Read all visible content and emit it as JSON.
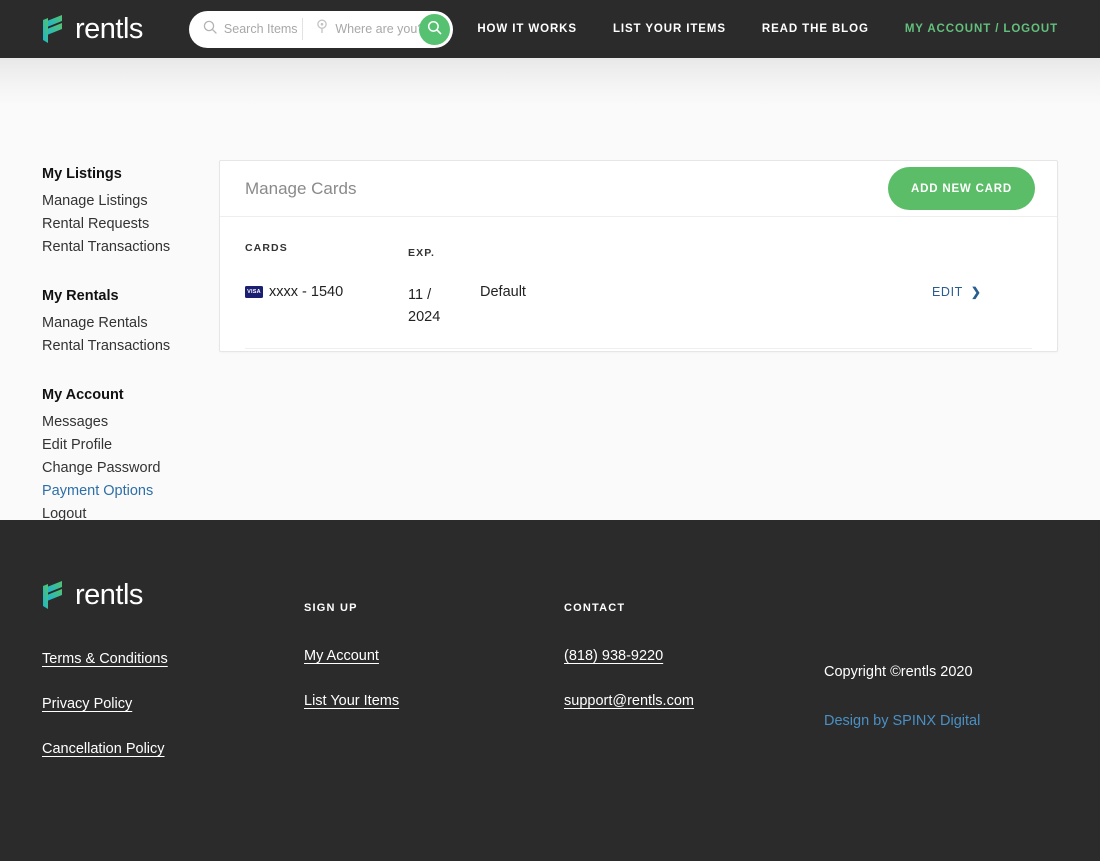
{
  "brand": {
    "name": "rentls",
    "logo_icon": "rentls-logo-mark",
    "accent_green": "#56c271",
    "accent_blue": "#2e6fa8",
    "dark": "#2b2b2b"
  },
  "header": {
    "search": {
      "items_placeholder": "Search Items",
      "items_value": "",
      "location_placeholder": "Where are you?",
      "location_value": "",
      "search_icon": "magnifier-icon",
      "location_icon": "map-pin-icon",
      "submit_icon": "magnifier-icon"
    },
    "nav": [
      {
        "label": "HOW IT WORKS",
        "accent": false
      },
      {
        "label": "LIST YOUR ITEMS",
        "accent": false
      },
      {
        "label": "READ THE BLOG",
        "accent": false
      },
      {
        "label": "MY ACCOUNT / LOGOUT",
        "accent": true
      }
    ]
  },
  "sidebar": {
    "groups": [
      {
        "heading": "My Listings",
        "items": [
          {
            "label": "Manage Listings",
            "active": false
          },
          {
            "label": "Rental Requests",
            "active": false
          },
          {
            "label": "Rental Transactions",
            "active": false
          }
        ]
      },
      {
        "heading": "My Rentals",
        "items": [
          {
            "label": "Manage Rentals",
            "active": false
          },
          {
            "label": "Rental Transactions",
            "active": false
          }
        ]
      },
      {
        "heading": "My Account",
        "items": [
          {
            "label": "Messages",
            "active": false
          },
          {
            "label": "Edit Profile",
            "active": false
          },
          {
            "label": "Change Password",
            "active": false
          },
          {
            "label": "Payment Options",
            "active": true
          },
          {
            "label": "Logout",
            "active": false
          }
        ]
      }
    ]
  },
  "panel": {
    "title": "Manage Cards",
    "add_button": "ADD NEW CARD",
    "columns": [
      "CARDS",
      "EXP.",
      "",
      ""
    ],
    "rows": [
      {
        "brand_icon": "visa-card-icon",
        "brand_label": "VISA",
        "number": "xxxx - 1540",
        "exp_month": "11 /",
        "exp_year": "2024",
        "status": "Default",
        "action": "EDIT",
        "action_icon": "chevron-right-icon"
      }
    ]
  },
  "footer": {
    "logo_icon": "rentls-logo-mark",
    "brand_name": "rentls",
    "legal_links": [
      "Terms & Conditions",
      "Privacy Policy",
      "Cancellation Policy"
    ],
    "signup": {
      "heading": "SIGN UP",
      "links": [
        "My Account",
        "List Your Items"
      ]
    },
    "contact": {
      "heading": "CONTACT",
      "phone": "(818) 938-9220",
      "email": "support@rentls.com"
    },
    "copyright": "Copyright ©rentls 2020",
    "credit": "Design by SPINX Digital"
  }
}
